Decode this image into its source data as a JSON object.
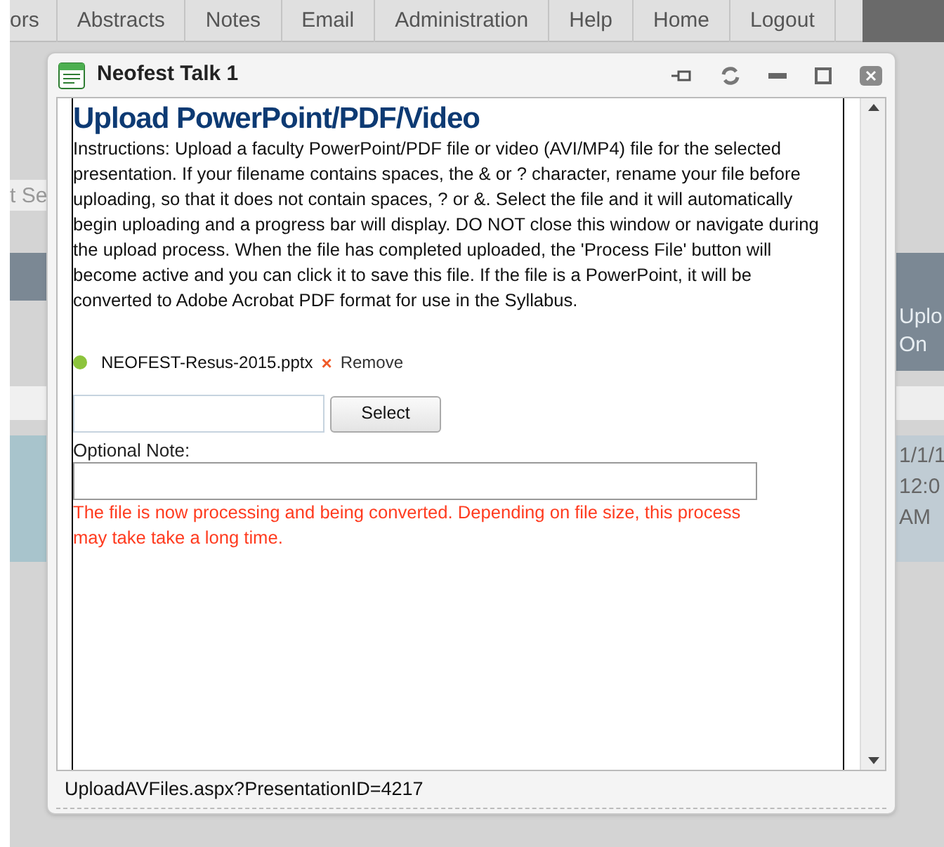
{
  "background_page": {
    "menu": [
      {
        "label": "ors"
      },
      {
        "label": "Abstracts"
      },
      {
        "label": "Notes"
      },
      {
        "label": "Email"
      },
      {
        "label": "Administration"
      },
      {
        "label": "Help"
      },
      {
        "label": "Home"
      },
      {
        "label": "Logout"
      }
    ],
    "fragments": {
      "left_field": "t Se",
      "header_1": "Uplo",
      "header_2": "On",
      "cell_1": "1/1/1",
      "cell_2": "12:0",
      "cell_3": "AM"
    }
  },
  "dialog": {
    "title": "Neofest Talk 1",
    "heading": "Upload PowerPoint/PDF/Video",
    "instructions": "Instructions: Upload a faculty PowerPoint/PDF file or video (AVI/MP4) file for the selected presentation. If your filename contains spaces, the & or ? character, rename your file before uploading, so that it does not contain spaces, ? or &. Select the file and it will automatically begin uploading and a progress bar will display. DO NOT close this window or navigate during the upload process. When the file has completed uploaded, the 'Process File' button will become active and you can click it to save this file. If the file is a PowerPoint, it will be converted to Adobe Acrobat PDF format for use in the Syllabus.",
    "file": {
      "name": "NEOFEST-Resus-2015.pptx",
      "remove_icon": "×",
      "remove": "Remove",
      "color": "#8cc43c"
    },
    "select_button": "Select",
    "note_label": "Optional Note:",
    "status_message": "The file is now processing and being converted. Depending on file size, this process may take take a long time.",
    "status_bar": "UploadAVFiles.aspx?PresentationID=4217"
  }
}
